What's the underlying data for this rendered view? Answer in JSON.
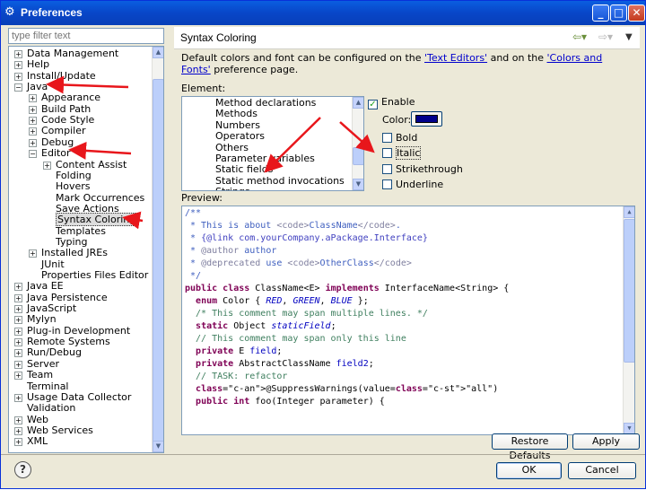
{
  "window": {
    "title": "Preferences",
    "title_icon": "gear-icon"
  },
  "filter": {
    "placeholder": "type filter text"
  },
  "tree": {
    "items": [
      {
        "label": "Data Management",
        "toggle": "+"
      },
      {
        "label": "Help",
        "toggle": "+"
      },
      {
        "label": "Install/Update",
        "toggle": "+"
      },
      {
        "label": "Java",
        "toggle": "−"
      },
      {
        "label": "Appearance",
        "toggle": "+"
      },
      {
        "label": "Build Path",
        "toggle": "+"
      },
      {
        "label": "Code Style",
        "toggle": "+"
      },
      {
        "label": "Compiler",
        "toggle": "+"
      },
      {
        "label": "Debug",
        "toggle": "+"
      },
      {
        "label": "Editor",
        "toggle": "−"
      },
      {
        "label": "Content Assist",
        "toggle": "+"
      },
      {
        "label": "Folding",
        "toggle": ""
      },
      {
        "label": "Hovers",
        "toggle": ""
      },
      {
        "label": "Mark Occurrences",
        "toggle": ""
      },
      {
        "label": "Save Actions",
        "toggle": ""
      },
      {
        "label": "Syntax Coloring",
        "toggle": ""
      },
      {
        "label": "Templates",
        "toggle": ""
      },
      {
        "label": "Typing",
        "toggle": ""
      },
      {
        "label": "Installed JREs",
        "toggle": "+"
      },
      {
        "label": "JUnit",
        "toggle": ""
      },
      {
        "label": "Properties Files Editor",
        "toggle": ""
      },
      {
        "label": "Java EE",
        "toggle": "+"
      },
      {
        "label": "Java Persistence",
        "toggle": "+"
      },
      {
        "label": "JavaScript",
        "toggle": "+"
      },
      {
        "label": "Mylyn",
        "toggle": "+"
      },
      {
        "label": "Plug-in Development",
        "toggle": "+"
      },
      {
        "label": "Remote Systems",
        "toggle": "+"
      },
      {
        "label": "Run/Debug",
        "toggle": "+"
      },
      {
        "label": "Server",
        "toggle": "+"
      },
      {
        "label": "Team",
        "toggle": "+"
      },
      {
        "label": "Terminal",
        "toggle": ""
      },
      {
        "label": "Usage Data Collector",
        "toggle": "+"
      },
      {
        "label": "Validation",
        "toggle": ""
      },
      {
        "label": "Web",
        "toggle": "+"
      },
      {
        "label": "Web Services",
        "toggle": "+"
      },
      {
        "label": "XML",
        "toggle": "+"
      }
    ],
    "selected": "Syntax Coloring"
  },
  "page": {
    "title": "Syntax Coloring",
    "desc_before": "Default colors and font can be configured on the ",
    "link1": "'Text Editors'",
    "desc_mid": " and on the ",
    "link2": "'Colors and Fonts'",
    "desc_after": " preference page.",
    "element_label": "Element:",
    "preview_label": "Preview:"
  },
  "elements": [
    "Method declarations",
    "Methods",
    "Numbers",
    "Operators",
    "Others",
    "Parameter variables",
    "Static fields",
    "Static method invocations",
    "Strings"
  ],
  "options": {
    "enable": {
      "label": "Enable",
      "checked": true
    },
    "color_label": "Color:",
    "color_value": "#00008b",
    "bold": {
      "label": "Bold",
      "checked": false
    },
    "italic": {
      "label": "Italic",
      "checked": false
    },
    "strikethrough": {
      "label": "Strikethrough",
      "checked": false
    },
    "underline": {
      "label": "Underline",
      "checked": false
    }
  },
  "preview": {
    "lines": [
      "/**",
      " * This is about <code>ClassName</code>.",
      " * {@link com.yourCompany.aPackage.Interface}",
      " * @author author",
      " * @deprecated use <code>OtherClass</code>",
      " */",
      "public class ClassName<E> implements InterfaceName<String> {",
      "  enum Color { RED, GREEN, BLUE };",
      "  /* This comment may span multiple lines. */",
      "  static Object staticField;",
      "  // This comment may span only this line",
      "  private E field;",
      "  private AbstractClassName field2;",
      "  // TASK: refactor",
      "  @SuppressWarnings(value=\"all\")",
      "  public int foo(Integer parameter) {"
    ]
  },
  "buttons": {
    "restore_defaults": "Restore Defaults",
    "apply": "Apply",
    "ok": "OK",
    "cancel": "Cancel"
  }
}
